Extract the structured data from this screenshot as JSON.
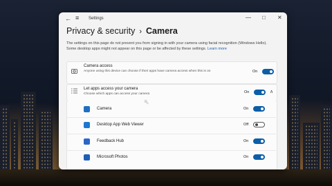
{
  "window": {
    "title": "Settings",
    "back_icon": "←",
    "menu_icon": "≡",
    "minimize_icon": "—",
    "maximize_icon": "□",
    "close_icon": "✕"
  },
  "breadcrumb": {
    "parent": "Privacy & security",
    "separator": "›",
    "current": "Camera"
  },
  "description": {
    "text": "The settings on this page do not prevent you from signing in with your camera using facial recognition (Windows Hello). Some desktop apps might not appear on this page or be affected by these settings.",
    "link": "Learn more"
  },
  "camera_access": {
    "title": "Camera access",
    "subtitle": "Anyone using this device can choose if their apps have camera access when this is on",
    "state": "On",
    "icon": "camera-icon"
  },
  "apps_access": {
    "title": "Let apps access your camera",
    "subtitle": "Choose which apps can access your camera",
    "state": "On",
    "expand_icon": "∧"
  },
  "apps": [
    {
      "name": "Camera",
      "state": "On",
      "color": "#1f6fc1"
    },
    {
      "name": "Desktop App Web Viewer",
      "state": "Off",
      "color": "#1b78d0"
    },
    {
      "name": "Feedback Hub",
      "state": "On",
      "color": "#2a66c9"
    },
    {
      "name": "Microsoft Photos",
      "state": "On",
      "color": "#1f5fb7"
    }
  ],
  "colors": {
    "accent": "#0c5ea8"
  }
}
